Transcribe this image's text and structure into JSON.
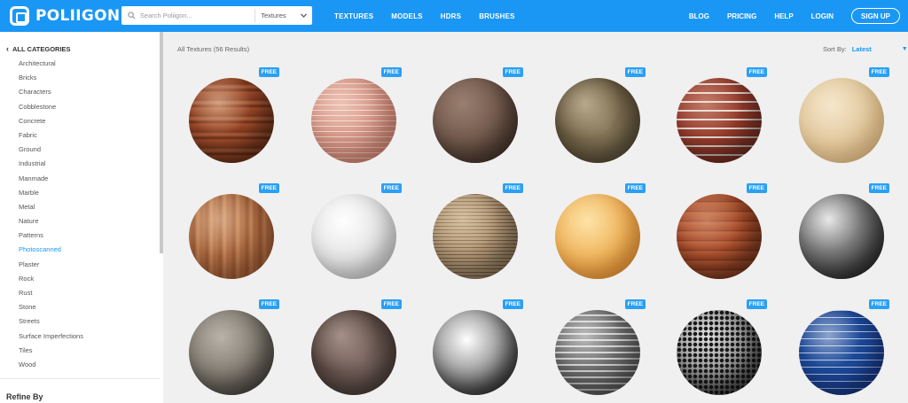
{
  "header": {
    "logo_text": "POLIIGON",
    "search": {
      "placeholder": "Search Poliigon...",
      "type_selected": "Textures"
    },
    "nav_main": [
      "TEXTURES",
      "MODELS",
      "HDRS",
      "BRUSHES"
    ],
    "nav_right": [
      "BLOG",
      "PRICING",
      "HELP",
      "LOGIN"
    ],
    "signup_label": "SIGN UP"
  },
  "sidebar": {
    "all_categories_label": "ALL CATEGORIES",
    "categories": [
      "Architectural",
      "Bricks",
      "Characters",
      "Cobblestone",
      "Concrete",
      "Fabric",
      "Ground",
      "Industrial",
      "Manmade",
      "Marble",
      "Metal",
      "Nature",
      "Patterns",
      "Photoscanned",
      "Plaster",
      "Rock",
      "Rust",
      "Stone",
      "Streets",
      "Surface Imperfections",
      "Tiles",
      "Wood"
    ],
    "active_category": "Photoscanned",
    "refine_label": "Refine By"
  },
  "main": {
    "results_label": "All Textures (56 Results)",
    "sort_label": "Sort By:",
    "sort_value": "Latest",
    "badge_label": "FREE",
    "tile_count": 18
  },
  "colors": {
    "brand": "#1a97f5",
    "badge": "#2aa0f5"
  }
}
